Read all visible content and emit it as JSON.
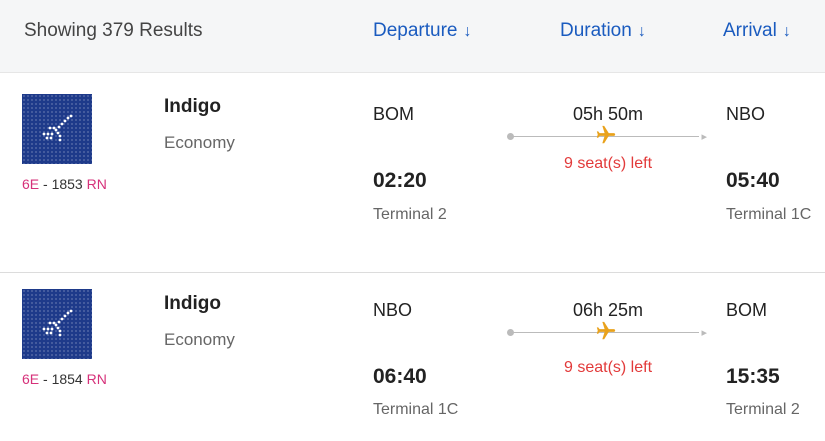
{
  "header": {
    "results_text": "Showing 379 Results",
    "sort_options": [
      {
        "label": "Departure",
        "arrow": "↓"
      },
      {
        "label": "Duration",
        "arrow": "↓"
      },
      {
        "label": "Arrival",
        "arrow": "↓"
      }
    ]
  },
  "colors": {
    "link_blue": "#1a5bbf",
    "seats_red": "#e23a3a",
    "code_pink": "#d6317a",
    "plane_orange": "#e9a21c",
    "logo_navy": "#1e3a8a"
  },
  "flights": [
    {
      "airline": "Indigo",
      "cabin": "Economy",
      "airline_code": "6E",
      "separator": " - ",
      "flight_number": "1853",
      "fare_code": "RN",
      "logo_icon": "indigo-logo-icon",
      "departure": {
        "city": "BOM",
        "time": "02:20",
        "terminal": "Terminal 2"
      },
      "duration": "05h 50m",
      "seats_left": "9 seat(s) left",
      "arrival": {
        "city": "NBO",
        "time": "05:40",
        "terminal": "Terminal 1C"
      }
    },
    {
      "airline": "Indigo",
      "cabin": "Economy",
      "airline_code": "6E",
      "separator": " - ",
      "flight_number": "1854",
      "fare_code": "RN",
      "logo_icon": "indigo-logo-icon",
      "departure": {
        "city": "NBO",
        "time": "06:40",
        "terminal": "Terminal 1C"
      },
      "duration": "06h 25m",
      "seats_left": "9 seat(s) left",
      "arrival": {
        "city": "BOM",
        "time": "15:35",
        "terminal": "Terminal 2"
      }
    }
  ]
}
